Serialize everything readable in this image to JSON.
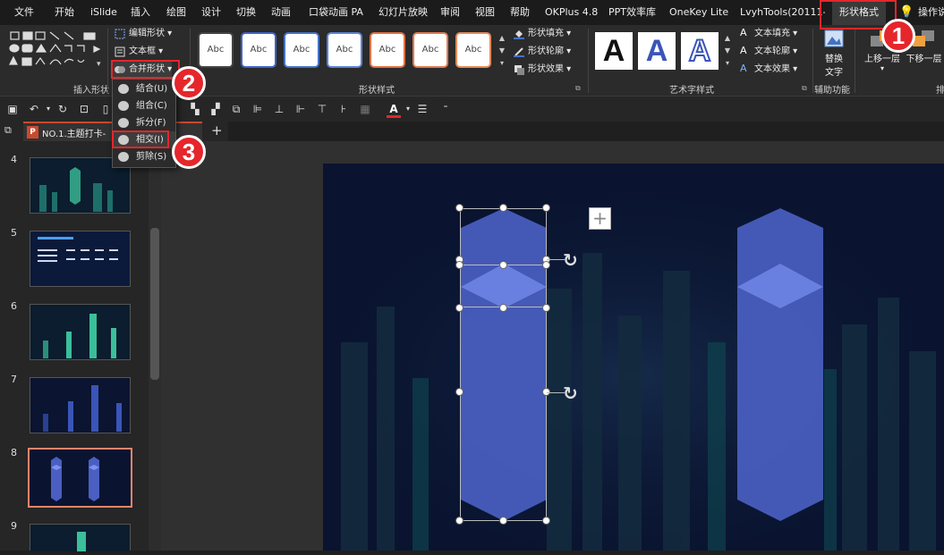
{
  "menubar": {
    "items": [
      {
        "label": "文件"
      },
      {
        "label": "开始"
      },
      {
        "label": "iSlide"
      },
      {
        "label": "插入"
      },
      {
        "label": "绘图"
      },
      {
        "label": "设计"
      },
      {
        "label": "切换"
      },
      {
        "label": "动画"
      },
      {
        "label": "口袋动画 PA"
      },
      {
        "label": "幻灯片放映"
      },
      {
        "label": "审阅"
      },
      {
        "label": "视图"
      },
      {
        "label": "帮助"
      },
      {
        "label": "OKPlus 4.8"
      },
      {
        "label": "PPT效率库"
      },
      {
        "label": "OneKey Lite"
      },
      {
        "label": "LvyhTools(20111-)"
      },
      {
        "label": "形状格式"
      },
      {
        "label": "操作说"
      }
    ]
  },
  "ribbon": {
    "insert_shapes_label": "插入形状",
    "edit_shape": "编辑形状",
    "text_box": "文本框",
    "merge_shapes": "合并形状",
    "shape_styles_label": "形状样式",
    "style_sample": "Abc",
    "shape_fill": "形状填充",
    "shape_outline": "形状轮廓",
    "shape_effect": "形状效果",
    "wordart_label": "艺术字样式",
    "wordart_letter": "A",
    "text_fill": "文本填充",
    "text_outline": "文本轮廓",
    "text_effect": "文本效果",
    "alt_text_1": "替换",
    "alt_text_2": "文字",
    "accessibility_label": "辅助功能",
    "bring_forward": "上移一层",
    "send_backward": "下移一层",
    "arrange_label": "排"
  },
  "merge_menu": {
    "items": [
      {
        "label": "结合(U)"
      },
      {
        "label": "组合(C)"
      },
      {
        "label": "拆分(F)"
      },
      {
        "label": "相交(I)"
      },
      {
        "label": "剪除(S)"
      }
    ]
  },
  "doc_tab": {
    "title": "NO.1.主题打卡-"
  },
  "slides": {
    "numbers": [
      "4",
      "5",
      "6",
      "7",
      "8",
      "9"
    ]
  },
  "badges": [
    "1",
    "2",
    "3"
  ],
  "colors": {
    "accent_red": "#e5262b",
    "shape_blue": "#4a5fc1",
    "shape_light": "#6a80e0",
    "slide_bg": "#0a1430"
  }
}
